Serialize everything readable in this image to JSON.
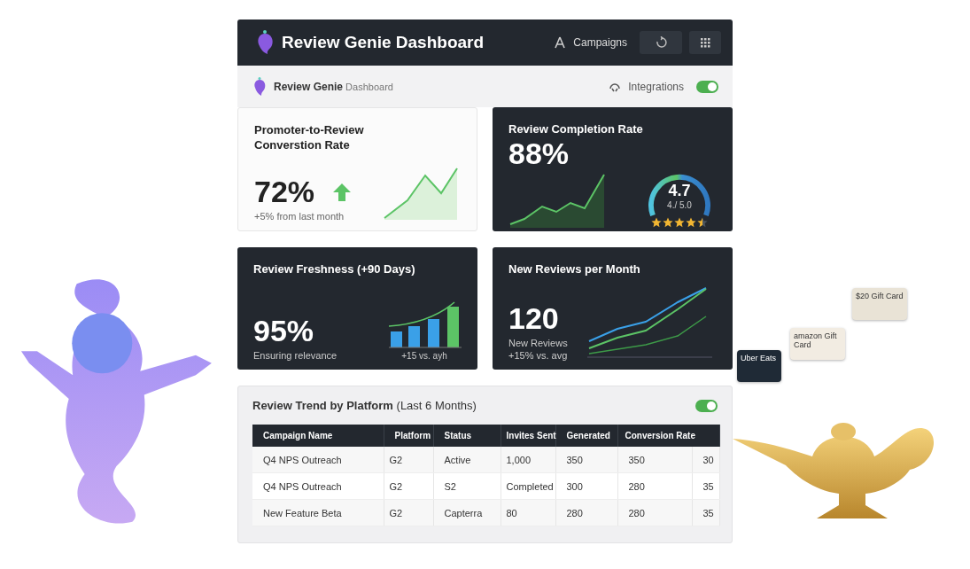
{
  "header": {
    "title": "Review Genie Dashboard",
    "nav_label": "Campaigns"
  },
  "subheader": {
    "brand": "**Review Genie** Dashboard",
    "integrations_label": "Integrations",
    "integrations_on": true
  },
  "cards": [
    {
      "kind": "conversion",
      "dark": false,
      "title": "Promoter-to-Review Converstion Rate",
      "value": "72%",
      "trend_up": true,
      "note": "+5% from last month"
    },
    {
      "kind": "gauge",
      "dark": true,
      "title": "Review Completion Rate",
      "value": "88%",
      "gauge_value": "4.7",
      "gauge_scale": "4./ 5.0",
      "stars": 4.5
    },
    {
      "kind": "bars",
      "dark": true,
      "title": "Review Freshness (+90 Days)",
      "value": "95%",
      "note": "Ensuring relevance",
      "chart_caption": "+15 vs. ayh"
    },
    {
      "kind": "lines",
      "dark": true,
      "title": "New Reviews per Month",
      "value": "120",
      "note": "New Reviews",
      "note_2": "+15% vs. avg"
    }
  ],
  "trend": {
    "title": "**Review Trend by Platform** (Last 6 Months)",
    "toggle_on": true,
    "columns": [
      "Campaign Name",
      "Platform",
      "Status",
      "Invites Sent",
      "Generated",
      "Conversion Rate"
    ],
    "rows": [
      {
        "cells": [
          "Q4 NPS Outreach",
          "G2",
          "Active",
          "1,000",
          "350",
          "350",
          "30"
        ]
      },
      {
        "cells": [
          "Q4 NPS Outreach",
          "G2",
          "S2",
          "Completed",
          "300",
          "280",
          "35"
        ]
      },
      {
        "cells": [
          "New Feature Beta",
          "G2",
          "Capterra",
          "80",
          "280",
          "280",
          "35"
        ]
      }
    ]
  },
  "illustration": {
    "gift_cards": [
      {
        "text": "$20 Gift Card",
        "color": "#e9e3d6"
      },
      {
        "text": "amazon Gift Card",
        "color": "#f2ece2"
      },
      {
        "text": "Uber Eats",
        "color": "#1f2a36"
      }
    ]
  }
}
